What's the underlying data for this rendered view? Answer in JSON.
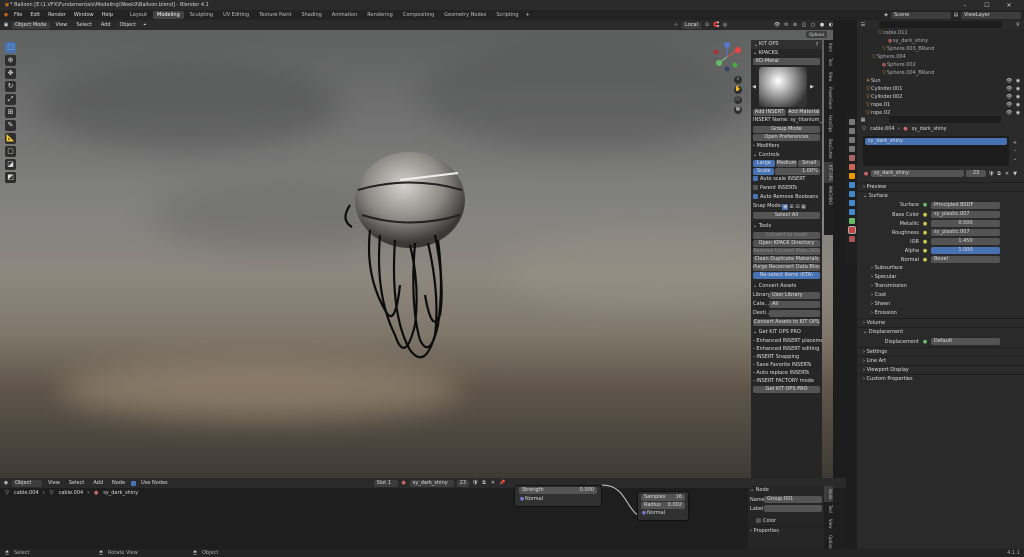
{
  "window": {
    "title": "* Balloon [E:\\1.VFX\\Fundamentals\\Modeling\\Week9\\Balloon.blend] - Blender 4.1"
  },
  "menu": [
    "File",
    "Edit",
    "Render",
    "Window",
    "Help"
  ],
  "workspaces": [
    "Layout",
    "Modeling",
    "Sculpting",
    "UV Editing",
    "Texture Paint",
    "Shading",
    "Animation",
    "Rendering",
    "Compositing",
    "Geometry Nodes",
    "Scripting"
  ],
  "active_workspace": "Modeling",
  "scene": {
    "label": "Scene",
    "view_layer": "ViewLayer"
  },
  "viewport_header": {
    "mode": "Object Mode",
    "items": [
      "View",
      "Select",
      "Add",
      "Object"
    ],
    "orientation": "Local",
    "options": "Options"
  },
  "kitops": {
    "title": "KIT OPS",
    "kpacks_label": "KPACKS",
    "pack": "KO-Metal",
    "add_insert": "Add INSERT",
    "add_material": "Add Material",
    "insert_name": "INSERT Name: sy_titanium_m...",
    "group_mode": "Group Mode",
    "open_prefs": "Open Preferences",
    "modifiers": "Modifiers",
    "controls": "Controls",
    "scale_tabs": [
      "Large",
      "Medium",
      "Small"
    ],
    "scale_label": "Scale",
    "scale_value": "1.00%",
    "checks": [
      {
        "label": "Auto scale INSERT",
        "on": true
      },
      {
        "label": "Parent INSERTs",
        "on": false
      },
      {
        "label": "Auto Remove Booleans",
        "on": true
      }
    ],
    "snap_mode": "Snap Mode:",
    "select_all": "Select All",
    "tools": "Tools",
    "tool_buttons": [
      {
        "label": "Convert to mesh",
        "style": "dim"
      },
      {
        "label": "Open KPACK Directory",
        "style": ""
      },
      {
        "label": "Remove Unused Mats (KO)",
        "style": "dim"
      },
      {
        "label": "Clean Duplicate Materials",
        "style": ""
      },
      {
        "label": "Purge Reconvert Data Blocks",
        "style": ""
      },
      {
        "label": "Re-select items (KTA)",
        "style": "blue"
      }
    ],
    "convert_assets": "Convert Assets",
    "library_label": "Library:",
    "library_value": "User Library",
    "cate_label": "Cate...",
    "cate_value": "All",
    "dest_label": "Desti...",
    "convert_button": "Convert Assets to KIT OPS",
    "pro_title": "Get KIT OPS PRO",
    "pro_features": [
      "- Enhanced INSERT placement",
      "- Enhanced INSERT editing",
      "- INSERT Snapping",
      "- Save Favorite INSERTs",
      "- Auto replace INSERTs",
      "- INSERT FACTORY mode"
    ],
    "pro_button": "Get KIT OPS PRO"
  },
  "vertical_tabs": [
    "Item",
    "Tool",
    "View",
    "PowerSave",
    "HardOps",
    "BoxCutter",
    "KIT OPS",
    "MACHIN3"
  ],
  "outliner": {
    "search_placeholder": "",
    "rows": [
      {
        "name": "cable.011",
        "icon": "▽",
        "indent": 20,
        "eye": false
      },
      {
        "name": "sy_dark_shiny",
        "icon": "●",
        "indent": 30,
        "eye": false
      },
      {
        "name": "Sphere.003_BRand",
        "icon": "▽",
        "indent": 24,
        "eye": false
      },
      {
        "name": "Sphere.004",
        "icon": "▽",
        "indent": 14,
        "eye": false
      },
      {
        "name": "Sphere.002",
        "icon": "●",
        "indent": 24,
        "eye": false
      },
      {
        "name": "Sphere.004_BRand",
        "icon": "▽",
        "indent": 24,
        "eye": false
      },
      {
        "name": "Sun",
        "icon": "☀",
        "indent": 8,
        "eye": true
      },
      {
        "name": "Cylinder.001",
        "icon": "▽",
        "indent": 8,
        "eye": true
      },
      {
        "name": "Cylinder.002",
        "icon": "▽",
        "indent": 8,
        "eye": true
      },
      {
        "name": "rope.01",
        "icon": "▽",
        "indent": 8,
        "eye": true
      },
      {
        "name": "rope.02",
        "icon": "▽",
        "indent": 8,
        "eye": true
      }
    ]
  },
  "properties": {
    "object": "cable.004",
    "material": "sy_dark_shiny",
    "slot": "sy_dark_shiny",
    "users": "23",
    "sections": {
      "preview": "Preview",
      "surface": "Surface",
      "volume": "Volume",
      "displacement": "Displacement",
      "settings": "Settings",
      "line_art": "Line Art",
      "viewport_display": "Viewport Display",
      "custom_properties": "Custom Properties"
    },
    "surface_label": "Surface",
    "surface_value": "Principled BSDF",
    "fields": [
      {
        "label": "Base Color",
        "value": "sy_plastic.007",
        "style": ""
      },
      {
        "label": "Metallic",
        "value": "0.000",
        "style": ""
      },
      {
        "label": "Roughness",
        "value": "sy_plastic.007",
        "style": ""
      },
      {
        "label": "IOR",
        "value": "1.450",
        "style": ""
      },
      {
        "label": "Alpha",
        "value": "1.000",
        "style": "blue"
      },
      {
        "label": "Normal",
        "value": "Bevel",
        "style": ""
      }
    ],
    "subsections": [
      "Subsurface",
      "Specular",
      "Transmission",
      "Coat",
      "Sheen",
      "Emission"
    ],
    "displacement_label": "Displacement",
    "displacement_value": "Default"
  },
  "node_editor": {
    "header_items": [
      "Object",
      "View",
      "Select",
      "Add",
      "Node"
    ],
    "use_nodes": "Use Nodes",
    "slot": "Slot 1",
    "material": "sy_dark_shiny",
    "users": "23",
    "breadcrumb": [
      "cable.004",
      "cable.004",
      "sy_dark_shiny"
    ],
    "bump_node": {
      "label": "Strength",
      "value": "0.000",
      "socket": "Normal"
    },
    "bevel_node": {
      "samples_label": "Samples",
      "samples": "16",
      "radius_label": "Radius",
      "radius": "0.002",
      "socket": "Normal"
    },
    "panel": {
      "title": "Node",
      "name_label": "Name:",
      "name_value": "Group.001",
      "label_label": "Label:",
      "color": "Color",
      "properties": "Properties"
    },
    "tabs": [
      "Node",
      "Tool",
      "View",
      "Options"
    ]
  },
  "statusbar": {
    "left": "Select",
    "mid": "Rotate View",
    "right": "Object",
    "version": "4.1.1"
  }
}
